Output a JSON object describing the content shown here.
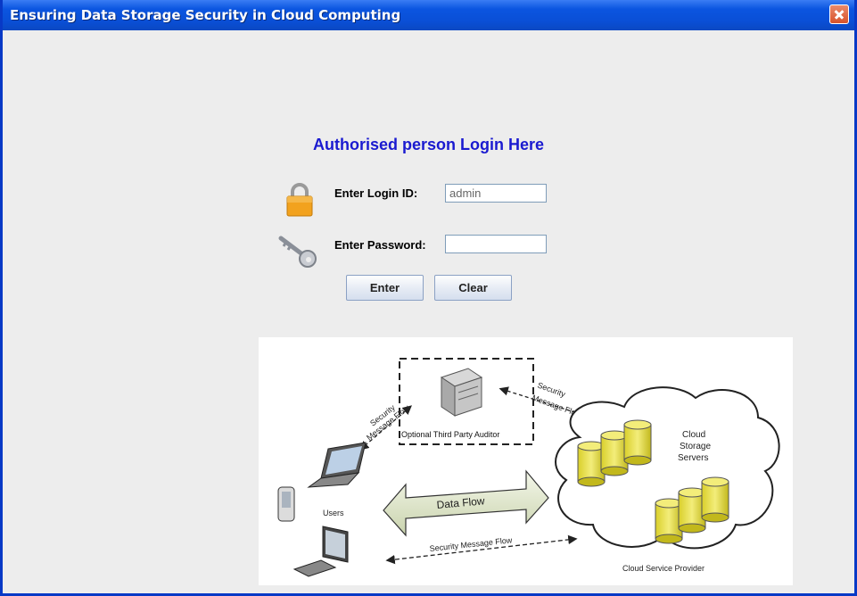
{
  "window": {
    "title": "Ensuring Data Storage Security in Cloud Computing"
  },
  "form": {
    "heading": "Authorised person Login Here",
    "login_label": "Enter Login ID:",
    "login_value": "admin",
    "password_label": "Enter Password:",
    "password_value": "",
    "enter_label": "Enter",
    "clear_label": "Clear"
  },
  "diagram": {
    "auditor_label": "Optional Third Party Auditor",
    "security_flow_left_1": "Security",
    "security_flow_left_2": "Message Flow",
    "security_flow_right_1": "Security",
    "security_flow_right_2": "Message Flow",
    "data_flow_label": "Data Flow",
    "users_label": "Users",
    "cloud_label_1": "Cloud",
    "cloud_label_2": "Storage",
    "cloud_label_3": "Servers",
    "bottom_flow_label": "Security Message Flow",
    "provider_label": "Cloud Service Provider"
  },
  "colors": {
    "heading": "#1a1ad0",
    "titlebar": "#0a4fd6",
    "cylinder": "#e8e04a"
  }
}
